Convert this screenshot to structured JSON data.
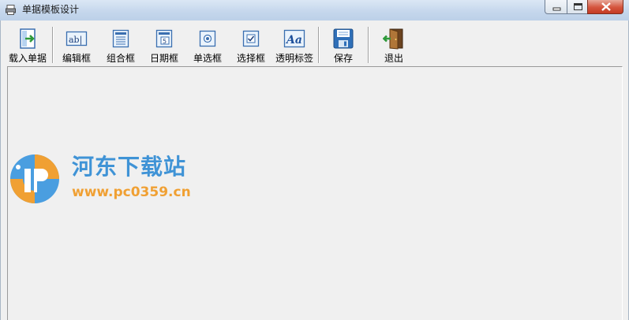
{
  "window": {
    "title": "单据模板设计"
  },
  "toolbar": {
    "load": "载入单据",
    "edit_box": "编辑框",
    "combo_box": "组合框",
    "date_box": "日期框",
    "radio_box": "单选框",
    "check_box": "选择框",
    "transparent_label": "透明标签",
    "save": "保存",
    "exit": "退出"
  },
  "icons": {
    "load": "load-document-icon",
    "edit_box": "edit-box-icon",
    "combo_box": "combo-box-icon",
    "date_box": "date-box-icon",
    "radio_box": "radio-icon",
    "check_box": "checkbox-icon",
    "transparent_label": "text-label-icon",
    "save": "floppy-disk-icon",
    "exit": "exit-door-icon"
  },
  "watermark": {
    "name": "河东下载站",
    "url": "www.pc0359.cn"
  },
  "colors": {
    "accent": "#3f93d6",
    "watermark_orange": "#f0a033",
    "close": "#c43a24"
  }
}
